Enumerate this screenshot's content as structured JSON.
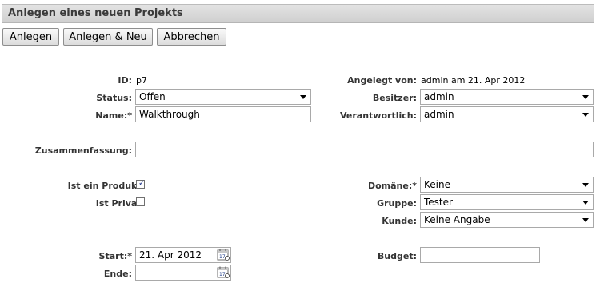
{
  "title": "Anlegen eines neuen Projekts",
  "buttons": {
    "create": "Anlegen",
    "create_new": "Anlegen & Neu",
    "cancel": "Abbrechen"
  },
  "form": {
    "id_label": "ID:",
    "id_value": "p7",
    "created_by_label": "Angelegt von:",
    "created_by_value": "admin am 21. Apr 2012",
    "status_label": "Status:",
    "status_value": "Offen",
    "owner_label": "Besitzer:",
    "owner_value": "admin",
    "name_label": "Name:*",
    "name_value": "Walkthrough",
    "responsible_label": "Verantwortlich:",
    "responsible_value": "admin",
    "summary_label": "Zusammenfassung:",
    "summary_value": "",
    "is_product_label": "Ist ein Produkt:",
    "is_product_checked": true,
    "is_private_label": "Ist Privat:",
    "is_private_checked": false,
    "domain_label": "Domäne:*",
    "domain_value": "Keine",
    "group_label": "Gruppe:",
    "group_value": "Tester",
    "customer_label": "Kunde:",
    "customer_value": "Keine Angabe",
    "start_label": "Start:*",
    "start_value": "21. Apr 2012",
    "end_label": "Ende:",
    "end_value": "",
    "budget_label": "Budget:",
    "budget_value": ""
  },
  "icons": {
    "calendar": "calendar-icon",
    "dropdown": "chevron-down-icon",
    "check": "checkmark"
  }
}
